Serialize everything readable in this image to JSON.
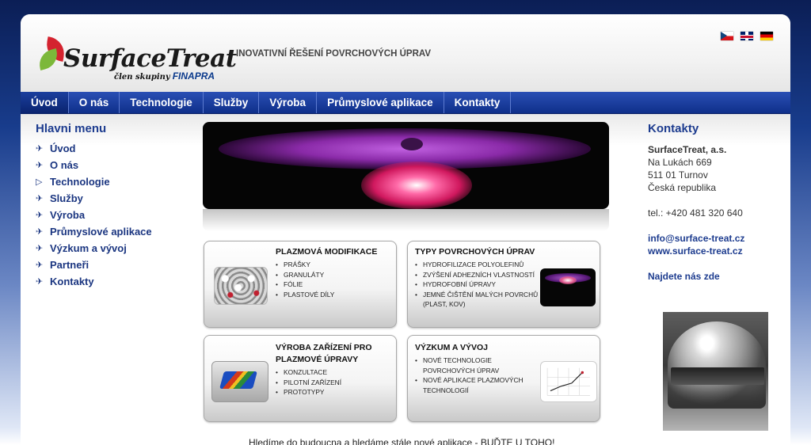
{
  "header": {
    "logo_text": "SurfaceTreat",
    "logo_sub": "člen skupiny",
    "logo_brand": "FINAPRA",
    "tagline": "INOVATIVNÍ ŘEŠENÍ POVRCHOVÝCH ÚPRAV",
    "languages": [
      "cz-flag-icon",
      "gb-flag-icon",
      "de-flag-icon"
    ]
  },
  "nav": {
    "items": [
      "Úvod",
      "O nás",
      "Technologie",
      "Služby",
      "Výroba",
      "Průmyslové aplikace",
      "Kontakty"
    ]
  },
  "sidebar": {
    "title": "Hlavni menu",
    "items": [
      {
        "label": "Úvod",
        "icon": "wing"
      },
      {
        "label": "O nás",
        "icon": "wing"
      },
      {
        "label": "Technologie",
        "icon": "triangle"
      },
      {
        "label": "Služby",
        "icon": "wing"
      },
      {
        "label": "Výroba",
        "icon": "wing"
      },
      {
        "label": "Průmyslové aplikace",
        "icon": "wing"
      },
      {
        "label": "Výzkum a vývoj",
        "icon": "wing"
      },
      {
        "label": "Partneři",
        "icon": "wing"
      },
      {
        "label": "Kontakty",
        "icon": "wing"
      }
    ]
  },
  "cards": [
    {
      "title": "PLAZMOVÁ MODIFIKACE",
      "items": [
        "PRÁŠKY",
        "GRANULÁTY",
        "FÓLIE",
        "PLASTOVÉ DÍLY"
      ]
    },
    {
      "title": "TYPY POVRCHOVÝCH ÚPRAV",
      "items": [
        "HYDROFILIZACE POLYOLEFINŮ",
        "ZVÝŠENÍ ADHEZNÍCH VLASTNOSTÍ",
        "HYDROFOBNÍ ÚPRAVY",
        "JEMNÉ ČIŠTĚNÍ MALÝCH POVRCHŮ (PLAST, KOV)"
      ]
    },
    {
      "title": "VÝROBA ZAŘÍZENÍ PRO PLAZMOVÉ ÚPRAVY",
      "items": [
        "KONZULTACE",
        "PILOTNÍ ZAŘÍZENÍ",
        "PROTOTYPY"
      ]
    },
    {
      "title": "VÝZKUM A VÝVOJ",
      "items": [
        "NOVÉ TECHNOLOGIE POVRCHOVÝCH ÚPRAV",
        "NOVÉ APLIKACE PLAZMOVÝCH TECHNOLOGIÍ"
      ]
    }
  ],
  "contacts": {
    "title": "Kontakty",
    "company": "SurfaceTreat, a.s.",
    "street": "Na Lukách 669",
    "city": "511 01 Turnov",
    "country": "Česká republika",
    "phone": "tel.: +420 481 320 640",
    "email": "info@surface-treat.cz",
    "web": "www.surface-treat.cz",
    "find_us": "Najdete nás zde"
  },
  "footer": {
    "text": "Hledíme do budoucna a hledáme stále nové aplikace - BUĎTE U TOHO!"
  }
}
